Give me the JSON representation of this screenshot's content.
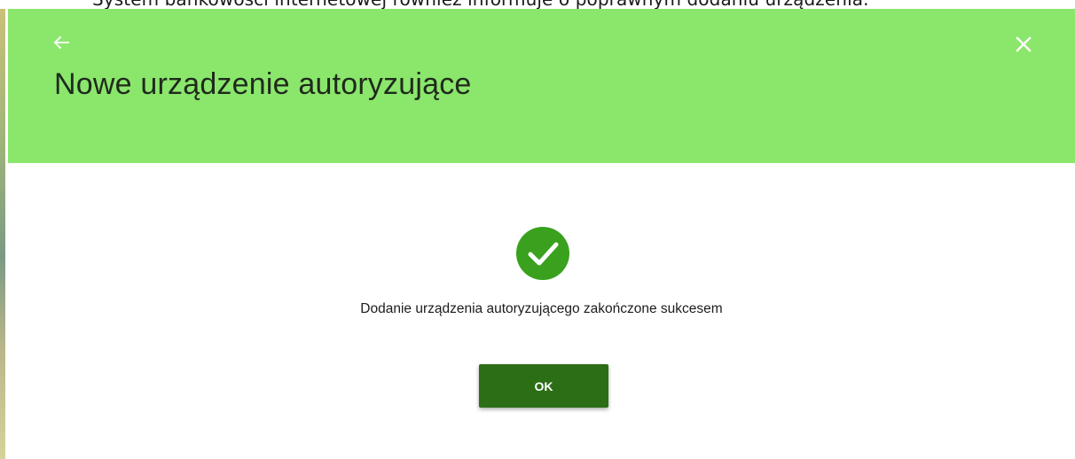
{
  "caption": {
    "text": "System bankowości internetowej również informuje o poprawnym dodaniu urządzenia."
  },
  "dialog": {
    "title": "Nowe urządzenie autoryzujące",
    "back_icon": "arrow-left-icon",
    "close_icon": "close-icon",
    "success_icon": "check-circle-icon",
    "message": "Dodanie urządzenia autoryzującego zakończone sukcesem",
    "ok_label": "OK"
  },
  "colors": {
    "header_bg": "#8be66c",
    "success_green": "#39a11e",
    "button_bg": "#2c6e16",
    "button_text": "#ffffff"
  }
}
